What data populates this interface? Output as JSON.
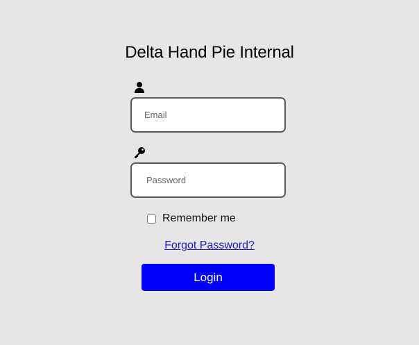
{
  "page": {
    "title": "Delta Hand Pie Internal"
  },
  "login_form": {
    "email": {
      "icon": "user-icon",
      "placeholder": "Email",
      "value": ""
    },
    "password": {
      "icon": "key-icon",
      "placeholder": "Password",
      "value": ""
    },
    "remember_me": {
      "label": "Remember me",
      "checked": false
    },
    "forgot_password_label": "Forgot Password?",
    "login_button_label": "Login"
  },
  "colors": {
    "background": "#e6e6e6",
    "button": "#0000ff",
    "link": "#1a1acc"
  }
}
